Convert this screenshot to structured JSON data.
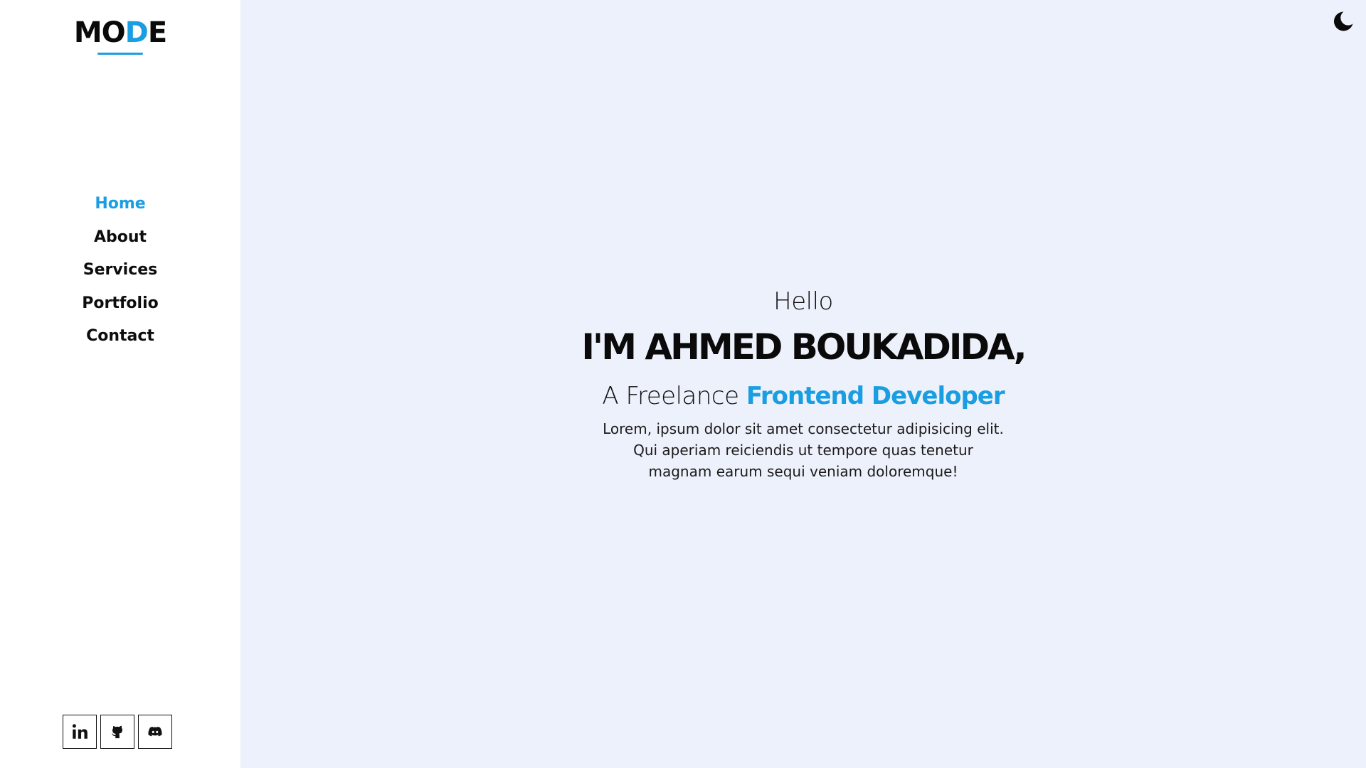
{
  "sidebar": {
    "logo": {
      "part1": "MO",
      "accent": "D",
      "part2": "E"
    },
    "nav": [
      {
        "label": "Home",
        "active": true
      },
      {
        "label": "About",
        "active": false
      },
      {
        "label": "Services",
        "active": false
      },
      {
        "label": "Portfolio",
        "active": false
      },
      {
        "label": "Contact",
        "active": false
      }
    ],
    "socials": [
      {
        "icon": "linkedin-icon"
      },
      {
        "icon": "github-icon"
      },
      {
        "icon": "discord-icon"
      }
    ]
  },
  "header": {
    "theme_toggle_icon": "moon-icon"
  },
  "hero": {
    "greeting": "Hello",
    "name": "I'M AHMED BOUKADIDA,",
    "tagline_prefix": "A Freelance",
    "tagline_role": "Frontend Developer",
    "description_lines": [
      "Lorem, ipsum dolor sit amet consectetur adipisicing elit.",
      "Qui aperiam reiciendis ut tempore quas tenetur",
      "magnam earum sequi veniam doloremque!"
    ]
  },
  "colors": {
    "accent": "#1a9ee2",
    "sidebar_bg": "#ffffff",
    "main_bg": "#edf1fb",
    "text": "#111111"
  }
}
